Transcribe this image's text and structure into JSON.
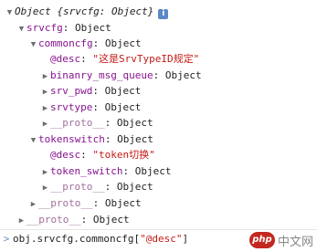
{
  "tree": {
    "root_label": "Object",
    "root_summary": "{srvcfg: Object}",
    "info_glyph": "i",
    "srvcfg_key": "srvcfg",
    "srvcfg_val": "Object",
    "commoncfg_key": "commoncfg",
    "commoncfg_val": "Object",
    "desc_key": "@desc",
    "desc_val": "\"这是SrvTypeID规定\"",
    "binanry_key": "binanry_msg_queue",
    "binanry_val": "Object",
    "srv_pwd_key": "srv_pwd",
    "srv_pwd_val": "Object",
    "srvtype_key": "srvtype",
    "srvtype_val": "Object",
    "proto_key": "__proto__",
    "proto_val": "Object",
    "tokenswitch_key": "tokenswitch",
    "tokenswitch_val": "Object",
    "token_desc_key": "@desc",
    "token_desc_val": "\"token切换\"",
    "token_switch_key": "token_switch",
    "token_switch_val": "Object"
  },
  "console": {
    "prompt_symbol": ">",
    "command_prefix": "obj.srvcfg.commoncfg[",
    "command_string": "\"@desc\"",
    "command_suffix": "]"
  },
  "watermark": {
    "logo_text": "php",
    "site_text": "中文网"
  }
}
